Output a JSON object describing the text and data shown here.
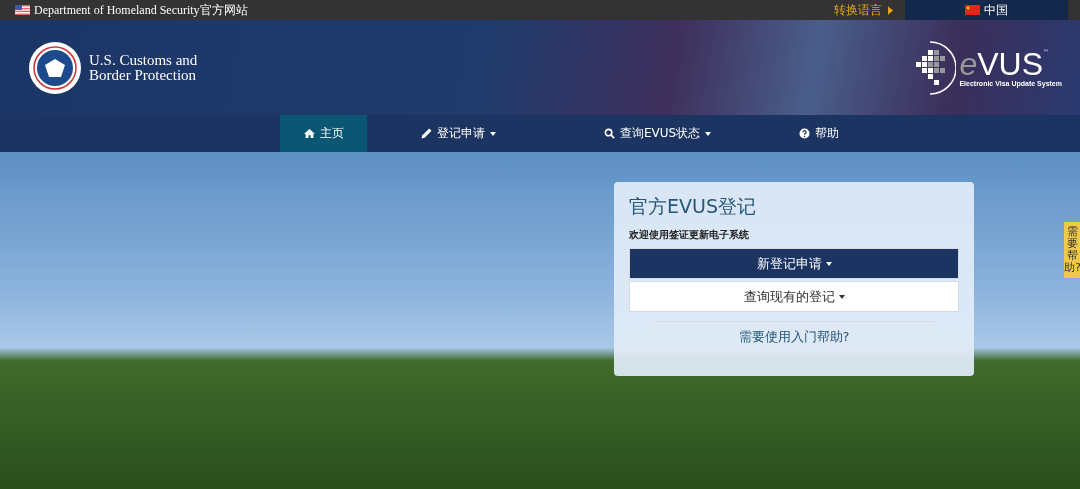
{
  "top_bar": {
    "site_notice": "Department of Homeland Security官方网站",
    "language_switch": "转换语言",
    "language": "中国"
  },
  "header": {
    "agency_name": "U.S. Customs and\nBorder Protection",
    "logo": {
      "letter": "e",
      "word": "VUS",
      "trademark": "™",
      "tagline": "Electronic Visa Update System"
    }
  },
  "nav": [
    {
      "kind": "home",
      "label": "主页",
      "dropdown": false,
      "selected": true
    },
    {
      "kind": "pencil",
      "label": "登记申请",
      "dropdown": true,
      "selected": false
    },
    {
      "kind": "search",
      "label": "查询EVUS状态",
      "dropdown": true,
      "selected": false
    },
    {
      "kind": "help",
      "label": "帮助",
      "dropdown": false,
      "selected": false
    }
  ],
  "card": {
    "title": "官方EVUS登记",
    "subtitle": "欢迎使用签证更新电子系统",
    "buttons": [
      {
        "label": "新登记申请",
        "primary": true
      },
      {
        "label": "查询现有的登记",
        "primary": false
      }
    ],
    "help_link": "需要使用入门帮助?"
  },
  "side_tab": "需要帮助?"
}
